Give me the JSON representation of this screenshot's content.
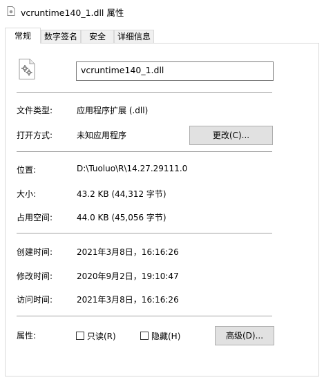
{
  "window": {
    "title": "vcruntime140_1.dll 属性"
  },
  "tabs": [
    {
      "label": "常规"
    },
    {
      "label": "数字签名"
    },
    {
      "label": "安全"
    },
    {
      "label": "详细信息"
    }
  ],
  "file": {
    "name": "vcruntime140_1.dll",
    "icon": "dll-file-gear-icon"
  },
  "type_row": {
    "label": "文件类型:",
    "value": "应用程序扩展 (.dll)"
  },
  "open_row": {
    "label": "打开方式:",
    "value": "未知应用程序",
    "button_label": "更改(C)..."
  },
  "location": {
    "label": "位置:",
    "value": "D:\\Tuoluo\\R\\14.27.29111.0"
  },
  "size": {
    "label": "大小:",
    "value": "43.2 KB (44,312 字节)"
  },
  "disk_size": {
    "label": "占用空间:",
    "value": "44.0 KB (45,056 字节)"
  },
  "created": {
    "label": "创建时间:",
    "value": "2021年3月8日，16:16:26"
  },
  "modified": {
    "label": "修改时间:",
    "value": "2020年9月2日，19:10:47"
  },
  "accessed": {
    "label": "访问时间:",
    "value": "2021年3月8日，16:16:26"
  },
  "attributes": {
    "label": "属性:",
    "readonly_label": "只读(R)",
    "hidden_label": "隐藏(H)",
    "advanced_label": "高级(D)..."
  }
}
